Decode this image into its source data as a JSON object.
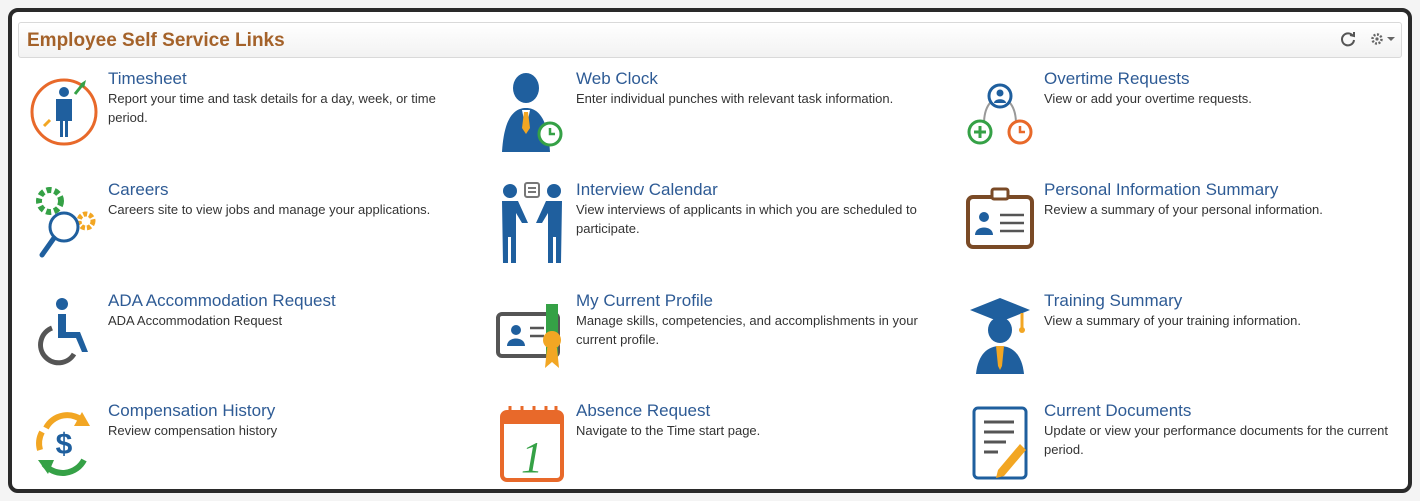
{
  "panel": {
    "title": "Employee Self Service Links",
    "refresh_icon": "refresh-icon",
    "settings_icon": "gear-icon"
  },
  "colors": {
    "title": "#a4622a",
    "link": "#2e5b95",
    "text": "#333333",
    "blue": "#1f5f9e",
    "orange": "#e8692a",
    "green": "#35a146",
    "gold": "#f2a623",
    "brown": "#7a4a26"
  },
  "tiles": [
    {
      "title": "Timesheet",
      "desc": "Report your time and task details for a day, week, or time period.",
      "icon": "timesheet-icon"
    },
    {
      "title": "Web Clock",
      "desc": "Enter individual punches with relevant task information.",
      "icon": "web-clock-icon"
    },
    {
      "title": "Overtime Requests",
      "desc": "View or add your overtime requests.",
      "icon": "overtime-icon"
    },
    {
      "title": "Careers",
      "desc": "Careers site to view jobs and manage your applications.",
      "icon": "careers-icon"
    },
    {
      "title": "Interview Calendar",
      "desc": "View interviews of applicants in which you are scheduled to participate.",
      "icon": "interview-icon"
    },
    {
      "title": "Personal Information Summary",
      "desc": "Review a summary of your personal information.",
      "icon": "id-card-icon"
    },
    {
      "title": "ADA Accommodation Request",
      "desc": "ADA Accommodation Request",
      "icon": "wheelchair-icon"
    },
    {
      "title": "My Current Profile",
      "desc": "Manage skills, competencies, and accomplishments in your current profile.",
      "icon": "profile-certificate-icon"
    },
    {
      "title": "Training Summary",
      "desc": "View a summary of your training information.",
      "icon": "graduate-icon"
    },
    {
      "title": "Compensation History",
      "desc": "Review compensation history",
      "icon": "dollar-cycle-icon"
    },
    {
      "title": "Absence Request",
      "desc": "Navigate to the Time start page.",
      "icon": "calendar-icon"
    },
    {
      "title": "Current Documents",
      "desc": "Update or view your performance documents for the current period.",
      "icon": "document-edit-icon"
    }
  ]
}
